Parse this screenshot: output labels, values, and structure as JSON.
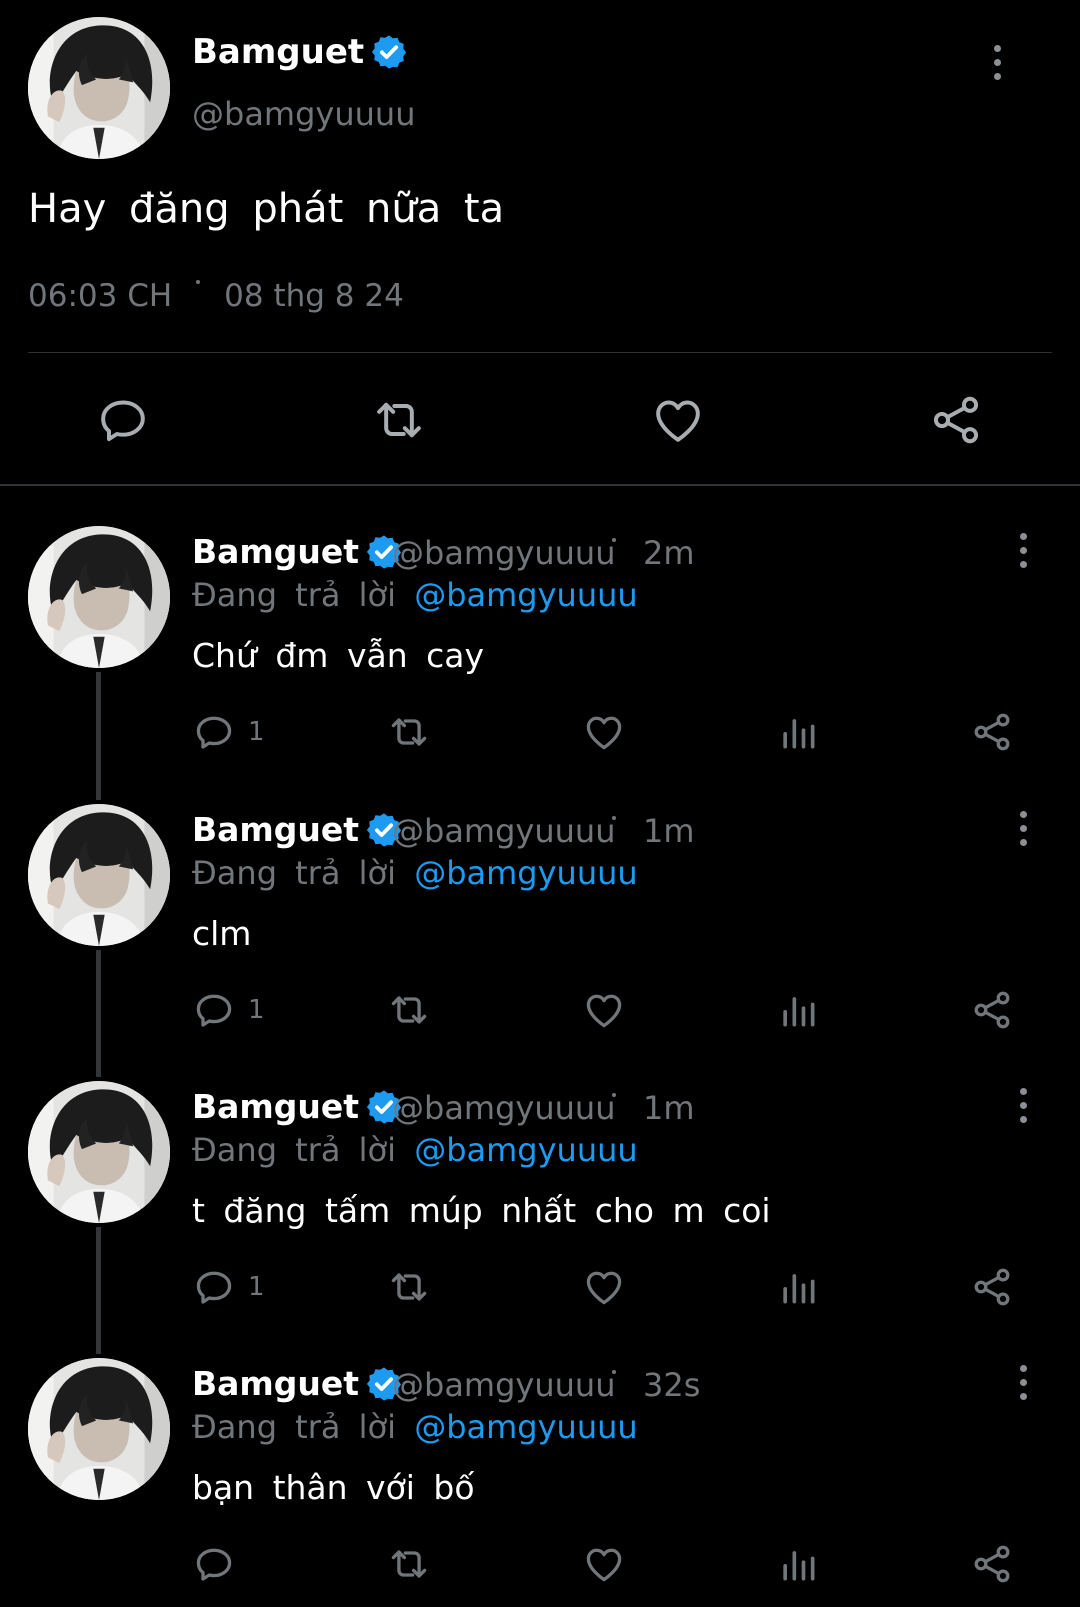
{
  "colors": {
    "background": "#000000",
    "text_primary": "#ffffff",
    "text_secondary": "#71767b",
    "accent": "#1d9bf0",
    "divider": "#2f3336"
  },
  "main_tweet": {
    "display_name": "Bamguet",
    "handle": "@bamgyuuuu",
    "text": "Hay đăng phát nữa ta",
    "time": "06:03 CH",
    "date": "08 thg 8 24",
    "icons": {
      "verified": "verified-badge-icon",
      "more": "more-vertical-icon",
      "reply": "reply-icon",
      "retweet": "retweet-icon",
      "like": "heart-icon",
      "share": "share-icon"
    }
  },
  "replies": [
    {
      "display_name": "Bamguet",
      "handle": "@bamgyuuuu",
      "time": "2m",
      "replying_prefix": "Đang trả lời",
      "replying_to": "@bamgyuuuu",
      "text": "Chứ đm vẫn cay",
      "reply_count": "1"
    },
    {
      "display_name": "Bamguet",
      "handle": "@bamgyuuuu",
      "time": "1m",
      "replying_prefix": "Đang trả lời",
      "replying_to": "@bamgyuuuu",
      "text": "clm",
      "reply_count": "1"
    },
    {
      "display_name": "Bamguet",
      "handle": "@bamgyuuuu",
      "time": "1m",
      "replying_prefix": "Đang trả lời",
      "replying_to": "@bamgyuuuu",
      "text": "t đăng tấm múp nhất cho m coi",
      "reply_count": "1"
    },
    {
      "display_name": "Bamguet",
      "handle": "@bamgyuuuu",
      "time": "32s",
      "replying_prefix": "Đang trả lời",
      "replying_to": "@bamgyuuuu",
      "text": "bạn thân với bố",
      "reply_count": ""
    }
  ]
}
